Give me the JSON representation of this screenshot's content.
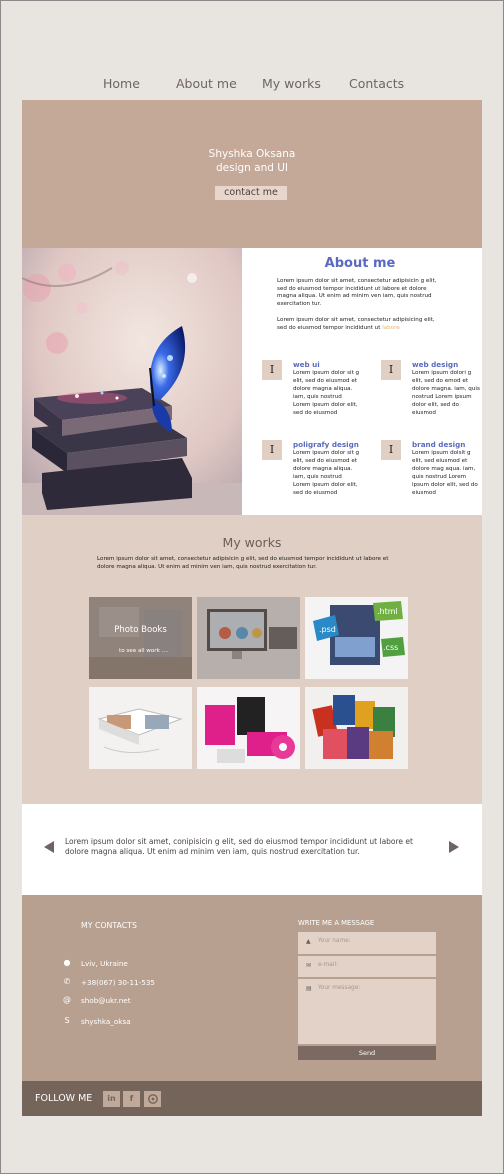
{
  "nav": {
    "items": [
      "Home",
      "About me",
      "My works",
      "Contacts"
    ]
  },
  "hero": {
    "name": "Shyshka Oksana",
    "role": "design and UI",
    "cta": "contact me"
  },
  "about": {
    "title": "About me",
    "p1": "Lorem ipsum dolor sit amet, consectetur adipisicin g elit, sed do eiusmod tempor incididunt ut labore et dolore magna aliqua. Ut enim ad minim ven iam, quis nostrud exercitation tur.",
    "p2": "Lorem ipsum dolor sit amet, consectetur adipisicing elit, sed do eiusmod tempor incididunt ut",
    "p2_highlight": "labore",
    "services": [
      {
        "icon": "I",
        "title": "web ui",
        "desc": "Lorem ipsum dolor sit g elit, sed do eiusmod et dolore magna aliqua. iam, quis nostrud Lorem ipsum dolor elit, sed do eiusmod"
      },
      {
        "icon": "I",
        "title": "web design",
        "desc": "Lorem ipsum dolori g elit, sed do emod et dolore magna. iam, quis nostrud Lorem ipsum dolor elit, sed do eiusmod"
      },
      {
        "icon": "I",
        "title": "poligrafy design",
        "desc": "Lorem ipsum dolor sit g elit, sed do eiusmod et dolore magna aliqua. iam, quis nostrud Lorem ipsum dolor elit, sed do eiusmod"
      },
      {
        "icon": "I",
        "title": "brand design",
        "desc": "Lorem ipsum dolsit g elit, sed eiusmod et dolore mag aqua. iam, quis nostrud Lorem ipsum dolor elit, sed do eiusmod"
      }
    ]
  },
  "works": {
    "title": "My works",
    "desc": "Lorem ipsum dolor sit amet, consectetur adipisicin g elit, sed do eiusmod tempor incididunt ut labore et dolore magna aliqua. Ut enim ad minim ven iam, quis nostrud exercitation tur.",
    "overlay_title": "Photo Books",
    "overlay_sub": "to see all work ....",
    "tile_labels": {
      "psd": ".psd",
      "html": ".html",
      "css": ".css"
    }
  },
  "slider": {
    "text": "Lorem ipsum dolor sit amet, conipisicin g elit, sed do eiusmod tempor incididunt ut labore et dolore magna aliqua. Ut enim ad minim ven iam, quis nostrud exercitation tur."
  },
  "contacts": {
    "title": "MY CONTACTS",
    "items": [
      {
        "icon": "location-icon",
        "value": "Lviv, Ukraine"
      },
      {
        "icon": "phone-icon",
        "value": "+38(067) 30-11-535"
      },
      {
        "icon": "at-icon",
        "value": "shob@ukr.net"
      },
      {
        "icon": "skype-icon",
        "value": "shyshka_oksa"
      }
    ],
    "message_title": "WRITE ME A MESSAGE",
    "name_placeholder": "Your name:",
    "email_placeholder": "e-mail:",
    "message_placeholder": "Your message:",
    "send": "Send"
  },
  "footer": {
    "follow": "FOLLOW ME",
    "social": [
      "in",
      "f",
      "gh"
    ]
  },
  "colors": {
    "hero": "#c4a898",
    "works_bg": "#e0cfc4",
    "contacts_bg": "#b8a090",
    "footer_bg": "#74645a",
    "accent": "#5a6ac0"
  }
}
